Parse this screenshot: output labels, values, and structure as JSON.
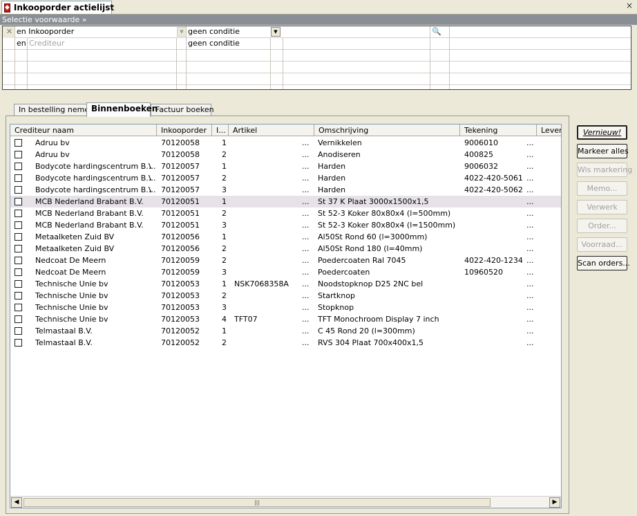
{
  "window": {
    "title": "Inkooporder actielijst",
    "close": "×"
  },
  "selection_bar": "Selectie voorwaarde »",
  "filter": {
    "rows": [
      {
        "conj": "en",
        "field": "Inkooporder",
        "condition": "geen conditie"
      },
      {
        "conj": "en",
        "field": "Crediteur",
        "condition": "geen conditie"
      }
    ]
  },
  "tabs": [
    {
      "label": "In bestelling nemen",
      "active": false
    },
    {
      "label": "Binnenboeken",
      "active": true
    },
    {
      "label": "Factuur boeken",
      "active": false
    }
  ],
  "grid": {
    "columns": [
      "Crediteur naam",
      "Inkooporder",
      "I...",
      "Artikel",
      "Omschrijving",
      "Tekening",
      "Leverd"
    ],
    "dots": "...",
    "rows": [
      {
        "crediteur": "Adruu bv",
        "order": "70120058",
        "line": "1",
        "artikel": "",
        "omschrijving": "Vernikkelen",
        "tekening": "9006010"
      },
      {
        "crediteur": "Adruu bv",
        "order": "70120058",
        "line": "2",
        "artikel": "",
        "omschrijving": "Anodiseren",
        "tekening": "400825"
      },
      {
        "crediteur": "Bodycote hardingscentrum B.V.",
        "order": "70120057",
        "line": "1",
        "artikel": "",
        "omschrijving": "Harden",
        "tekening": "9006032"
      },
      {
        "crediteur": "Bodycote hardingscentrum B.V.",
        "order": "70120057",
        "line": "2",
        "artikel": "",
        "omschrijving": "Harden",
        "tekening": "4022-420-5061"
      },
      {
        "crediteur": "Bodycote hardingscentrum B.V.",
        "order": "70120057",
        "line": "3",
        "artikel": "",
        "omschrijving": "Harden",
        "tekening": "4022-420-5062"
      },
      {
        "crediteur": "MCB Nederland Brabant B.V.",
        "order": "70120051",
        "line": "1",
        "artikel": "",
        "omschrijving": "St 37 K Plaat 3000x1500x1,5",
        "tekening": "",
        "selected": true
      },
      {
        "crediteur": "MCB Nederland Brabant B.V.",
        "order": "70120051",
        "line": "2",
        "artikel": "",
        "omschrijving": "St 52-3 Koker 80x80x4 (l=500mm)",
        "tekening": ""
      },
      {
        "crediteur": "MCB Nederland Brabant B.V.",
        "order": "70120051",
        "line": "3",
        "artikel": "",
        "omschrijving": "St 52-3 Koker 80x80x4 (l=1500mm)",
        "tekening": ""
      },
      {
        "crediteur": "Metaalketen Zuid BV",
        "order": "70120056",
        "line": "1",
        "artikel": "",
        "omschrijving": "Al50St Rond 60 (l=3000mm)",
        "tekening": ""
      },
      {
        "crediteur": "Metaalketen Zuid BV",
        "order": "70120056",
        "line": "2",
        "artikel": "",
        "omschrijving": "Al50St Rond 180 (l=40mm)",
        "tekening": ""
      },
      {
        "crediteur": "Nedcoat De Meern",
        "order": "70120059",
        "line": "2",
        "artikel": "",
        "omschrijving": "Poedercoaten Ral 7045",
        "tekening": "4022-420-1234"
      },
      {
        "crediteur": "Nedcoat De Meern",
        "order": "70120059",
        "line": "3",
        "artikel": "",
        "omschrijving": "Poedercoaten",
        "tekening": "10960520"
      },
      {
        "crediteur": "Technische Unie bv",
        "order": "70120053",
        "line": "1",
        "artikel": "NSK7068358A",
        "omschrijving": "Noodstopknop D25 2NC bel",
        "tekening": ""
      },
      {
        "crediteur": "Technische Unie bv",
        "order": "70120053",
        "line": "2",
        "artikel": "",
        "omschrijving": "Startknop",
        "tekening": ""
      },
      {
        "crediteur": "Technische Unie bv",
        "order": "70120053",
        "line": "3",
        "artikel": "",
        "omschrijving": "Stopknop",
        "tekening": ""
      },
      {
        "crediteur": "Technische Unie bv",
        "order": "70120053",
        "line": "4",
        "artikel": "TFT07",
        "omschrijving": "TFT Monochroom Display 7 inch",
        "tekening": ""
      },
      {
        "crediteur": "Telmastaal B.V.",
        "order": "70120052",
        "line": "1",
        "artikel": "",
        "omschrijving": "C 45 Rond 20 (l=300mm)",
        "tekening": ""
      },
      {
        "crediteur": "Telmastaal B.V.",
        "order": "70120052",
        "line": "2",
        "artikel": "",
        "omschrijving": "RVS 304 Plaat 700x400x1,5",
        "tekening": ""
      }
    ]
  },
  "buttons": [
    {
      "label": "Vernieuw!",
      "enabled": true,
      "default": true
    },
    {
      "label": "Markeer alles",
      "enabled": true
    },
    {
      "label": "Wis markering",
      "enabled": false
    },
    {
      "label": "Memo...",
      "enabled": false
    },
    {
      "label": "Verwerk",
      "enabled": false
    },
    {
      "label": "Order...",
      "enabled": false
    },
    {
      "label": "Voorraad...",
      "enabled": false
    },
    {
      "label": "Scan orders...",
      "enabled": true
    }
  ],
  "scroll_grip": "|||"
}
